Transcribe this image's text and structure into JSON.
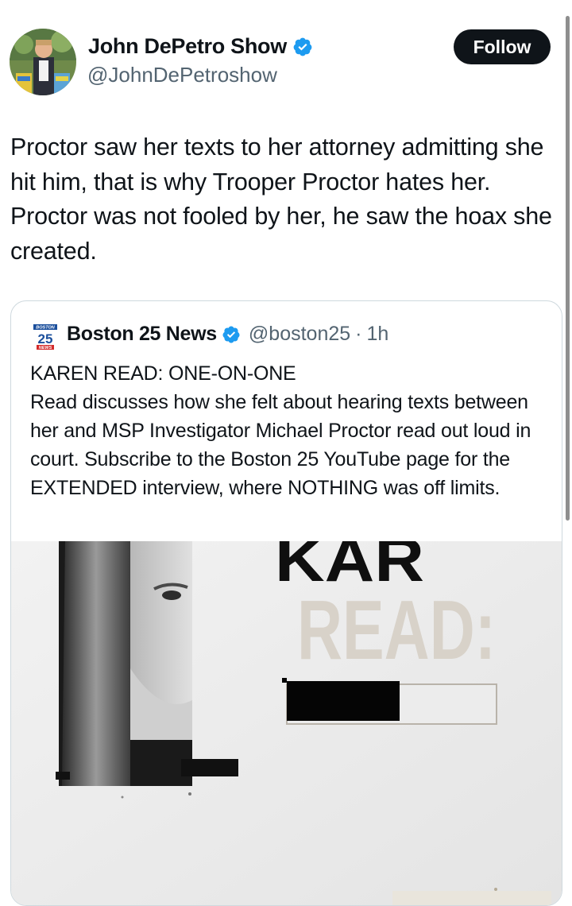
{
  "tweet": {
    "author": {
      "display_name": "John DePetro Show",
      "handle": "@JohnDePetroshow",
      "verified_icon": "verified-badge-icon",
      "verified_color": "#1d9bf0"
    },
    "follow_label": "Follow",
    "text": "Proctor saw her texts to her attorney admitting she hit him, that is why Trooper Proctor hates her. Proctor was not fooled by her, he saw the hoax she created."
  },
  "quote": {
    "logo_top": "BOSTON",
    "logo_number": "25",
    "logo_bottom": "NEWS",
    "display_name": "Boston 25 News",
    "handle": "@boston25",
    "separator": "·",
    "time": "1h",
    "text": "KAREN READ: ONE-ON-ONE\nRead discusses how she felt about hearing texts between her and MSP Investigator Michael Proctor read out loud in court. Subscribe to the Boston 25 YouTube page for the EXTENDED interview, where NOTHING was off limits.",
    "media": {
      "overlay_line1": "KAR",
      "overlay_line2": "READ:"
    }
  }
}
